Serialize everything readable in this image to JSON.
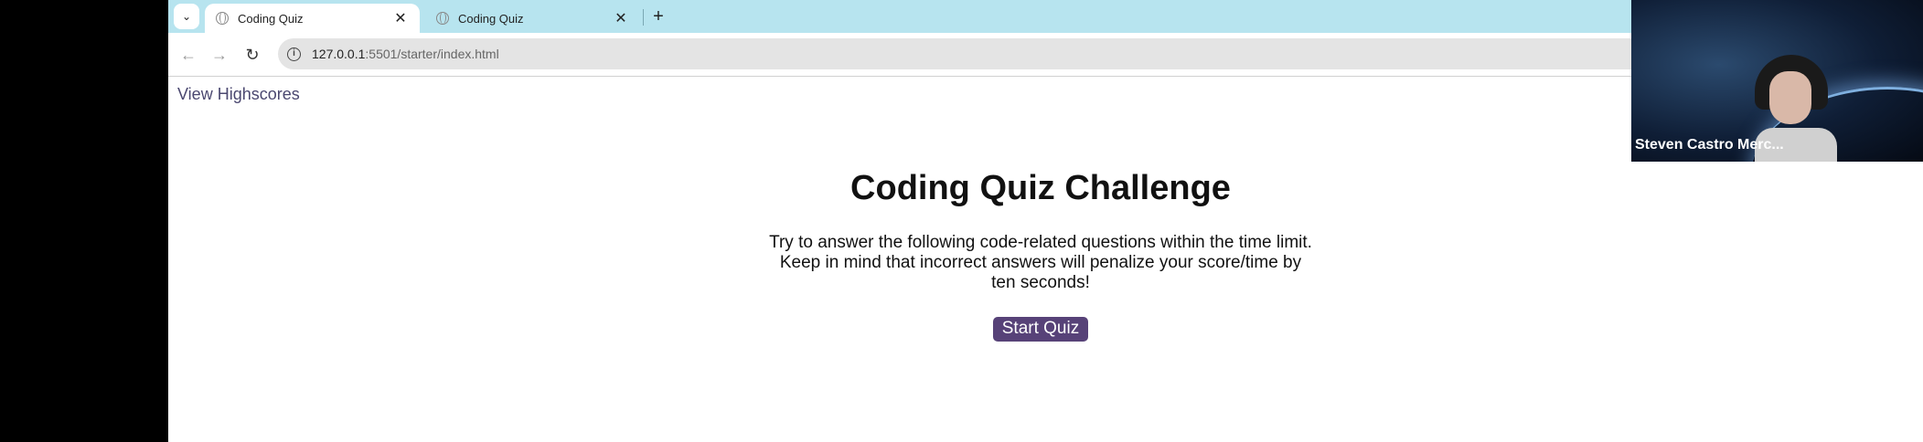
{
  "browser": {
    "tabs": [
      {
        "title": "Coding Quiz",
        "active": true
      },
      {
        "title": "Coding Quiz",
        "active": false
      }
    ],
    "url_host": "127.0.0.1",
    "url_path": ":5501/starter/index.html"
  },
  "page": {
    "highscores_link": "View Highscores",
    "title": "Coding Quiz Challenge",
    "description": "Try to answer the following code-related questions within the time limit. Keep in mind that incorrect answers will penalize your score/time by ten seconds!",
    "start_button": "Start Quiz"
  },
  "webcam": {
    "name": "Steven Castro Merc..."
  },
  "colors": {
    "tabstrip": "#b7e4ef",
    "link": "#4b4870",
    "button": "#574278"
  },
  "icons": [
    "tab-menu-icon",
    "globe-icon",
    "close-icon",
    "plus-icon",
    "back-arrow-icon",
    "forward-arrow-icon",
    "reload-icon",
    "info-icon"
  ]
}
